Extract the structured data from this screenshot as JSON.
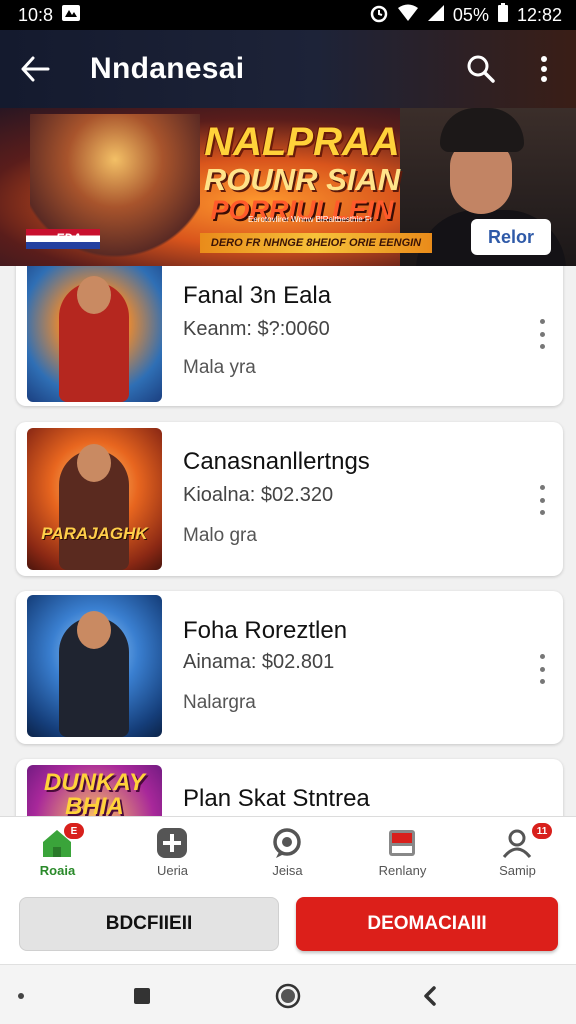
{
  "status_bar": {
    "time": "10:8",
    "battery": "05%",
    "clock": "12:82"
  },
  "app_bar": {
    "title": "Nndanesai"
  },
  "banner": {
    "title_line1": "NALPRAA",
    "title_line2": "ROUNR SIAN",
    "title_line3": "PORRIULLEIN",
    "subline": "Eerotovlirer Wnnw BlRaltbesthie Fr",
    "flag_text": "EDA",
    "strip_text": "DERO FR NHNGE 8HEIOF ORIE EENGIN",
    "cta_label": "Relor"
  },
  "cards": [
    {
      "title": "Fanal 3n Eala",
      "price": "Keanm: $?:0060",
      "subtitle": "Mala yra",
      "thumb_text": ""
    },
    {
      "title": "Canasnanllertngs",
      "price": "Kioalna: $02.320",
      "subtitle": "Malo gra",
      "thumb_text": "PARAJAGHK"
    },
    {
      "title": "Foha Roreztlen",
      "price": "Ainama: $02.801",
      "subtitle": "Nalargra",
      "thumb_text": ""
    },
    {
      "title": "Plan Skat Stntrea",
      "price": "",
      "subtitle": "",
      "thumb_text": "DUNKAY BHIA"
    }
  ],
  "bottom_nav": [
    {
      "label": "Roaia",
      "icon": "home-icon",
      "badge": "E"
    },
    {
      "label": "Ueria",
      "icon": "plus-icon",
      "badge": ""
    },
    {
      "label": "Jeisa",
      "icon": "chat-icon",
      "badge": ""
    },
    {
      "label": "Renlany",
      "icon": "wallet-icon",
      "badge": ""
    },
    {
      "label": "Samip",
      "icon": "profile-icon",
      "badge": "11"
    }
  ],
  "actions": {
    "secondary_label": "BDCFIIEII",
    "primary_label": "DEOMACIAIII"
  },
  "colors": {
    "primary_red": "#dc1f1a",
    "active_green": "#2a8a2a",
    "app_bar_dark": "#141a2e"
  }
}
